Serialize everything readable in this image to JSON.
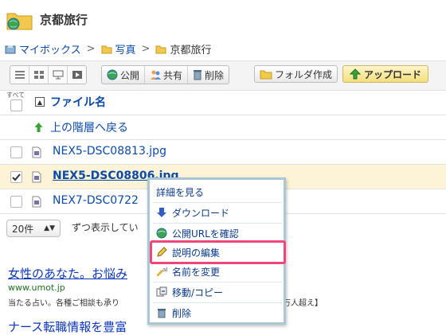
{
  "page": {
    "title": "京都旅行"
  },
  "breadcrumb": {
    "root": "マイボックス",
    "sep": ">",
    "mid": "写真",
    "current": "京都旅行"
  },
  "toolbar": {
    "public_label": "公開",
    "share_label": "共有",
    "delete_label": "削除",
    "new_folder_label": "フォルダ作成",
    "upload_label": "アップロード"
  },
  "list": {
    "select_all_label": "すべて",
    "sort_glyph": "▲",
    "column_name": "ファイル名",
    "up_label": "上の階層へ戻る",
    "files": [
      {
        "name": "NEX5-DSC08813.jpg",
        "checked": false
      },
      {
        "name": "NEX5-DSC08806.jpg",
        "checked": true
      },
      {
        "name": "NEX7-DSC0722",
        "checked": false
      }
    ]
  },
  "pager": {
    "per_page_value": "20件",
    "per_page_suffix": "ずつ表示してい"
  },
  "ad": {
    "title": "女性のあなた。お悩み",
    "url": "www.umot.jp",
    "desc": "当たる占い。各種ご相談も承り",
    "tail": "万人超え】",
    "title2": "ナース転職情報を豊富"
  },
  "context_menu": {
    "items": [
      {
        "label": "詳細を見る",
        "icon": "none"
      },
      {
        "label": "ダウンロード",
        "icon": "download-arrow-icon"
      },
      {
        "label": "公開URLを確認",
        "icon": "globe-icon"
      },
      {
        "label": "説明の編集",
        "icon": "pencil-icon",
        "highlighted": true
      },
      {
        "label": "名前を変更",
        "icon": "rename-icon"
      },
      {
        "label": "移動/コピー",
        "icon": "move-copy-icon"
      },
      {
        "label": "削除",
        "icon": "trash-icon"
      }
    ]
  },
  "colors": {
    "link": "#0b4aa6",
    "selected_row": "#fdf3d6",
    "menu_border": "#a9c7d6",
    "highlight": "#f0477a"
  }
}
